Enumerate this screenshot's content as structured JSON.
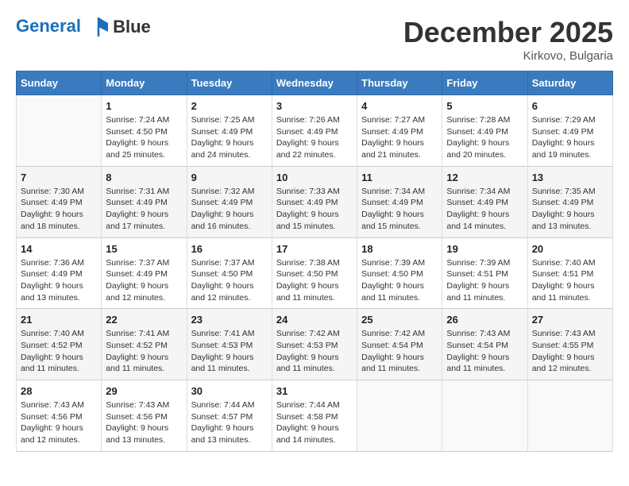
{
  "header": {
    "logo_line1": "General",
    "logo_line2": "Blue",
    "month": "December 2025",
    "location": "Kirkovo, Bulgaria"
  },
  "weekdays": [
    "Sunday",
    "Monday",
    "Tuesday",
    "Wednesday",
    "Thursday",
    "Friday",
    "Saturday"
  ],
  "weeks": [
    [
      {
        "day": "",
        "sunrise": "",
        "sunset": "",
        "daylight": ""
      },
      {
        "day": "1",
        "sunrise": "Sunrise: 7:24 AM",
        "sunset": "Sunset: 4:50 PM",
        "daylight": "Daylight: 9 hours and 25 minutes."
      },
      {
        "day": "2",
        "sunrise": "Sunrise: 7:25 AM",
        "sunset": "Sunset: 4:49 PM",
        "daylight": "Daylight: 9 hours and 24 minutes."
      },
      {
        "day": "3",
        "sunrise": "Sunrise: 7:26 AM",
        "sunset": "Sunset: 4:49 PM",
        "daylight": "Daylight: 9 hours and 22 minutes."
      },
      {
        "day": "4",
        "sunrise": "Sunrise: 7:27 AM",
        "sunset": "Sunset: 4:49 PM",
        "daylight": "Daylight: 9 hours and 21 minutes."
      },
      {
        "day": "5",
        "sunrise": "Sunrise: 7:28 AM",
        "sunset": "Sunset: 4:49 PM",
        "daylight": "Daylight: 9 hours and 20 minutes."
      },
      {
        "day": "6",
        "sunrise": "Sunrise: 7:29 AM",
        "sunset": "Sunset: 4:49 PM",
        "daylight": "Daylight: 9 hours and 19 minutes."
      }
    ],
    [
      {
        "day": "7",
        "sunrise": "Sunrise: 7:30 AM",
        "sunset": "Sunset: 4:49 PM",
        "daylight": "Daylight: 9 hours and 18 minutes."
      },
      {
        "day": "8",
        "sunrise": "Sunrise: 7:31 AM",
        "sunset": "Sunset: 4:49 PM",
        "daylight": "Daylight: 9 hours and 17 minutes."
      },
      {
        "day": "9",
        "sunrise": "Sunrise: 7:32 AM",
        "sunset": "Sunset: 4:49 PM",
        "daylight": "Daylight: 9 hours and 16 minutes."
      },
      {
        "day": "10",
        "sunrise": "Sunrise: 7:33 AM",
        "sunset": "Sunset: 4:49 PM",
        "daylight": "Daylight: 9 hours and 15 minutes."
      },
      {
        "day": "11",
        "sunrise": "Sunrise: 7:34 AM",
        "sunset": "Sunset: 4:49 PM",
        "daylight": "Daylight: 9 hours and 15 minutes."
      },
      {
        "day": "12",
        "sunrise": "Sunrise: 7:34 AM",
        "sunset": "Sunset: 4:49 PM",
        "daylight": "Daylight: 9 hours and 14 minutes."
      },
      {
        "day": "13",
        "sunrise": "Sunrise: 7:35 AM",
        "sunset": "Sunset: 4:49 PM",
        "daylight": "Daylight: 9 hours and 13 minutes."
      }
    ],
    [
      {
        "day": "14",
        "sunrise": "Sunrise: 7:36 AM",
        "sunset": "Sunset: 4:49 PM",
        "daylight": "Daylight: 9 hours and 13 minutes."
      },
      {
        "day": "15",
        "sunrise": "Sunrise: 7:37 AM",
        "sunset": "Sunset: 4:49 PM",
        "daylight": "Daylight: 9 hours and 12 minutes."
      },
      {
        "day": "16",
        "sunrise": "Sunrise: 7:37 AM",
        "sunset": "Sunset: 4:50 PM",
        "daylight": "Daylight: 9 hours and 12 minutes."
      },
      {
        "day": "17",
        "sunrise": "Sunrise: 7:38 AM",
        "sunset": "Sunset: 4:50 PM",
        "daylight": "Daylight: 9 hours and 11 minutes."
      },
      {
        "day": "18",
        "sunrise": "Sunrise: 7:39 AM",
        "sunset": "Sunset: 4:50 PM",
        "daylight": "Daylight: 9 hours and 11 minutes."
      },
      {
        "day": "19",
        "sunrise": "Sunrise: 7:39 AM",
        "sunset": "Sunset: 4:51 PM",
        "daylight": "Daylight: 9 hours and 11 minutes."
      },
      {
        "day": "20",
        "sunrise": "Sunrise: 7:40 AM",
        "sunset": "Sunset: 4:51 PM",
        "daylight": "Daylight: 9 hours and 11 minutes."
      }
    ],
    [
      {
        "day": "21",
        "sunrise": "Sunrise: 7:40 AM",
        "sunset": "Sunset: 4:52 PM",
        "daylight": "Daylight: 9 hours and 11 minutes."
      },
      {
        "day": "22",
        "sunrise": "Sunrise: 7:41 AM",
        "sunset": "Sunset: 4:52 PM",
        "daylight": "Daylight: 9 hours and 11 minutes."
      },
      {
        "day": "23",
        "sunrise": "Sunrise: 7:41 AM",
        "sunset": "Sunset: 4:53 PM",
        "daylight": "Daylight: 9 hours and 11 minutes."
      },
      {
        "day": "24",
        "sunrise": "Sunrise: 7:42 AM",
        "sunset": "Sunset: 4:53 PM",
        "daylight": "Daylight: 9 hours and 11 minutes."
      },
      {
        "day": "25",
        "sunrise": "Sunrise: 7:42 AM",
        "sunset": "Sunset: 4:54 PM",
        "daylight": "Daylight: 9 hours and 11 minutes."
      },
      {
        "day": "26",
        "sunrise": "Sunrise: 7:43 AM",
        "sunset": "Sunset: 4:54 PM",
        "daylight": "Daylight: 9 hours and 11 minutes."
      },
      {
        "day": "27",
        "sunrise": "Sunrise: 7:43 AM",
        "sunset": "Sunset: 4:55 PM",
        "daylight": "Daylight: 9 hours and 12 minutes."
      }
    ],
    [
      {
        "day": "28",
        "sunrise": "Sunrise: 7:43 AM",
        "sunset": "Sunset: 4:56 PM",
        "daylight": "Daylight: 9 hours and 12 minutes."
      },
      {
        "day": "29",
        "sunrise": "Sunrise: 7:43 AM",
        "sunset": "Sunset: 4:56 PM",
        "daylight": "Daylight: 9 hours and 13 minutes."
      },
      {
        "day": "30",
        "sunrise": "Sunrise: 7:44 AM",
        "sunset": "Sunset: 4:57 PM",
        "daylight": "Daylight: 9 hours and 13 minutes."
      },
      {
        "day": "31",
        "sunrise": "Sunrise: 7:44 AM",
        "sunset": "Sunset: 4:58 PM",
        "daylight": "Daylight: 9 hours and 14 minutes."
      },
      {
        "day": "",
        "sunrise": "",
        "sunset": "",
        "daylight": ""
      },
      {
        "day": "",
        "sunrise": "",
        "sunset": "",
        "daylight": ""
      },
      {
        "day": "",
        "sunrise": "",
        "sunset": "",
        "daylight": ""
      }
    ]
  ]
}
